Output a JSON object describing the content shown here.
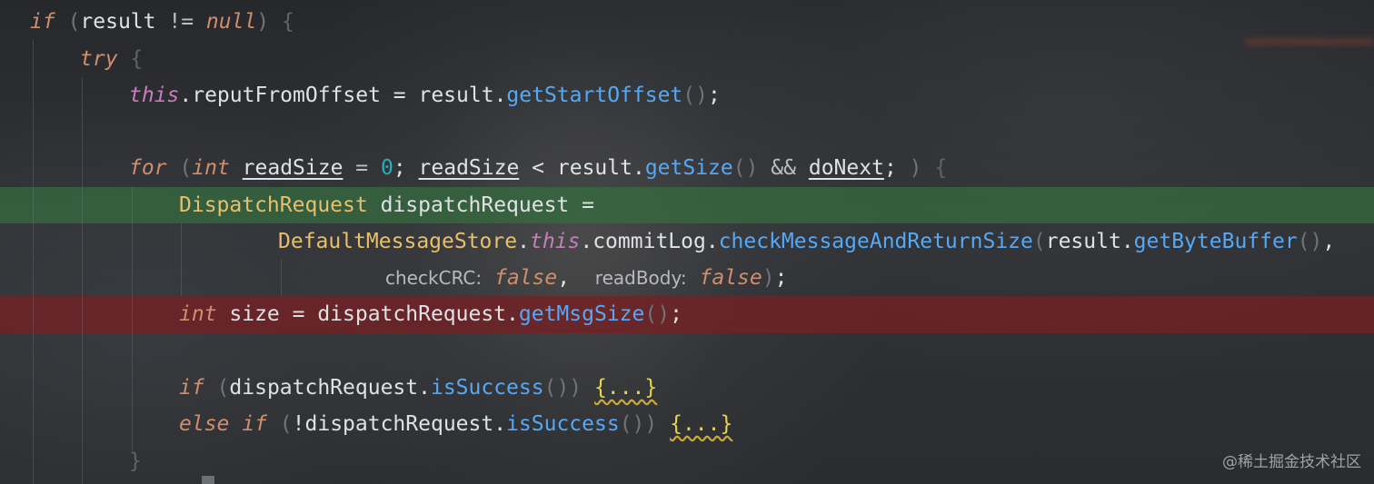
{
  "code": {
    "l1": {
      "kw_if": "if",
      "open": "(",
      "result": "result",
      "op": " != ",
      "null": "null",
      "close": ")",
      "brace": " {"
    },
    "l2": {
      "kw_try": "try",
      "brace": " {"
    },
    "l3": {
      "this": "this",
      "field": ".reputFromOffset = result.",
      "method": "getStartOffset",
      "parens": "()",
      "semi": ";"
    },
    "l4": {
      "kw_for": "for",
      "open": " (",
      "kw_int": "int",
      "sp": " ",
      "var1": "readSize",
      "eq": " = ",
      "zero": "0",
      "semi1": "; ",
      "var2": "readSize",
      "lt": " < result.",
      "method": "getSize",
      "parens": "()",
      "and": " && ",
      "var3": "doNext",
      "semi2": "; ",
      "close": ")",
      "brace": " {"
    },
    "l5": {
      "type": "DispatchRequest",
      "rest": " dispatchRequest ="
    },
    "l6": {
      "type": "DefaultMessageStore",
      "dot1": ".",
      "this": "this",
      "field": ".commitLog.",
      "method": "checkMessageAndReturnSize",
      "open": "(",
      "arg": "result.",
      "method2": "getByteBuffer",
      "parens": "()",
      "comma": ","
    },
    "l7": {
      "hint1": "checkCRC:",
      "val1": "false",
      "comma": ",",
      "hint2": "readBody:",
      "val2": "false",
      "close": ")",
      "semi": ";"
    },
    "l8": {
      "kw_int": "int",
      "rest": " size = dispatchRequest.",
      "method": "getMsgSize",
      "parens": "()",
      "semi": ";"
    },
    "l10": {
      "kw_if": "if",
      "open": " (",
      "obj": "dispatchRequest.",
      "method": "isSuccess",
      "parens": "()",
      "close": ")",
      "fold": "{...}"
    },
    "l11": {
      "kw_else": "else",
      "kw_if": "if",
      "open": " (",
      "obj": "!dispatchRequest.",
      "method": "isSuccess",
      "parens": "()",
      "close": ")",
      "fold": "{...}"
    },
    "l12": {
      "brace": "}"
    }
  },
  "watermark": "@稀土掘金技术社区",
  "colors": {
    "keyword": "#cf8e6d",
    "method": "#56a8f5",
    "type": "#e8bf6a",
    "number": "#2aacb8",
    "this": "#c77dbb",
    "highlight_green": "#346e3e",
    "highlight_red": "#762024"
  }
}
